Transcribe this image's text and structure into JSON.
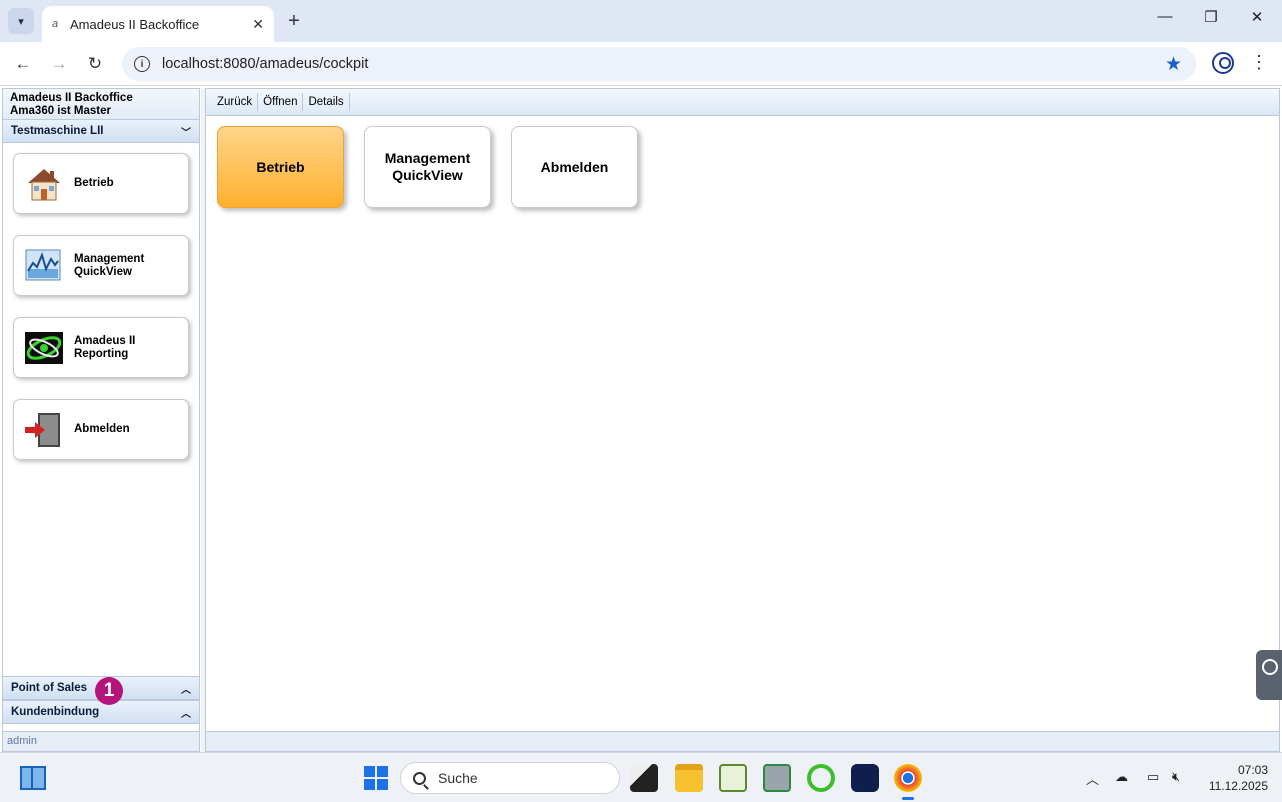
{
  "browser": {
    "tab_title": "Amadeus II Backoffice",
    "tab_favicon": "a",
    "url": "localhost:8080/amadeus/cockpit"
  },
  "sidebar": {
    "header_line1": "Amadeus II Backoffice",
    "header_line2": "Ama360 ist Master",
    "section_title": "Testmaschine LII",
    "tiles": [
      {
        "label": "Betrieb",
        "icon": "house-icon"
      },
      {
        "label": "Management\nQuickView",
        "icon": "chart-icon"
      },
      {
        "label": "Amadeus II\nReporting",
        "icon": "reporting-icon"
      },
      {
        "label": "Abmelden",
        "icon": "logout-door-icon"
      }
    ],
    "bottom_sections": [
      "Point of Sales",
      "Kundenbindung"
    ],
    "footer_user": "admin"
  },
  "main": {
    "toolbar": [
      "Zurück",
      "Öffnen",
      "Details"
    ],
    "tiles": [
      {
        "label": "Betrieb",
        "active": true
      },
      {
        "label": "Management\nQuickView",
        "active": false
      },
      {
        "label": "Abmelden",
        "active": false
      }
    ]
  },
  "annotation_badge": "1",
  "taskbar": {
    "search_placeholder": "Suche",
    "time": "07:03",
    "date": "11.12.2025"
  },
  "colors": {
    "active_tile": "#ffb02e",
    "accent_blue": "#1a5fd0",
    "badge": "#b5157a"
  }
}
